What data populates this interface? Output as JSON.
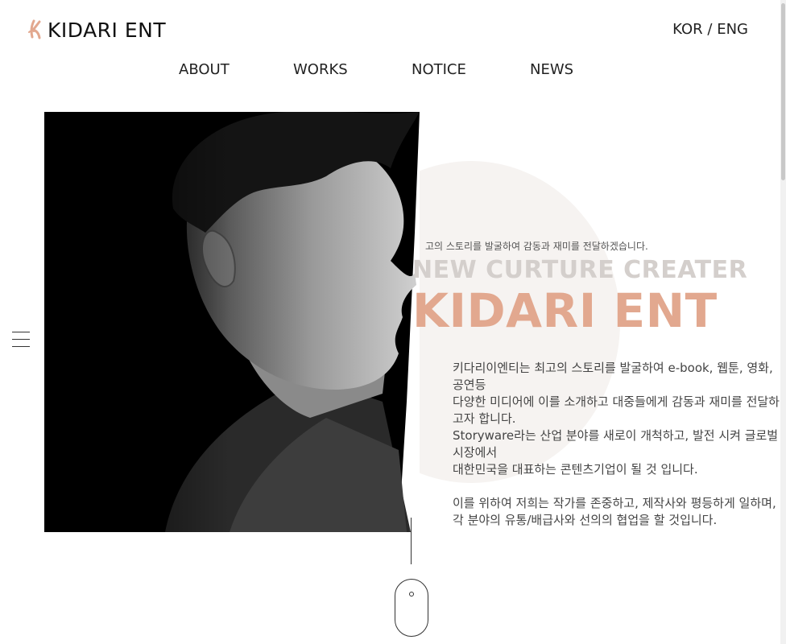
{
  "header": {
    "logo_text": "KIDARI ENT",
    "lang_kor": "KOR",
    "lang_sep": "/",
    "lang_eng": "ENG"
  },
  "nav": {
    "items": [
      "ABOUT",
      "WORKS",
      "NOTICE",
      "NEWS"
    ]
  },
  "hero": {
    "subline": "고의 스토리를 발굴하여 감동과 재미를 전달하겠습니다.",
    "title_small": "NEW CURTURE CREATER",
    "title_big": "KIDARI ENT",
    "desc_lines": [
      "키다리이엔티는 최고의 스토리를 발굴하여 e-book, 웹툰, 영화, 공연등",
      "다양한 미디어에 이를 소개하고 대중들에게 감동과 재미를 전달하고자 합니다.",
      "Storyware라는 산업 분야를 새로이 개척하고, 발전 시켜 글로벌 시장에서",
      "대한민국을 대표하는 콘텐츠기업이 될 것 입니다."
    ],
    "desc_lines2": [
      "이를 위하여 저희는 작가를 존중하고, 제작사와 평등하게 일하며,",
      "각 분야의 유통/배급사와 선의의 협업을 할 것입니다."
    ]
  },
  "colors": {
    "accent": "#e2a88f",
    "subtitle_gray": "#d4cfcc",
    "text": "#444444"
  },
  "icons": {
    "logo_mark": "stylized-k-icon",
    "menu": "hamburger-icon",
    "scroll": "mouse-scroll-icon"
  }
}
